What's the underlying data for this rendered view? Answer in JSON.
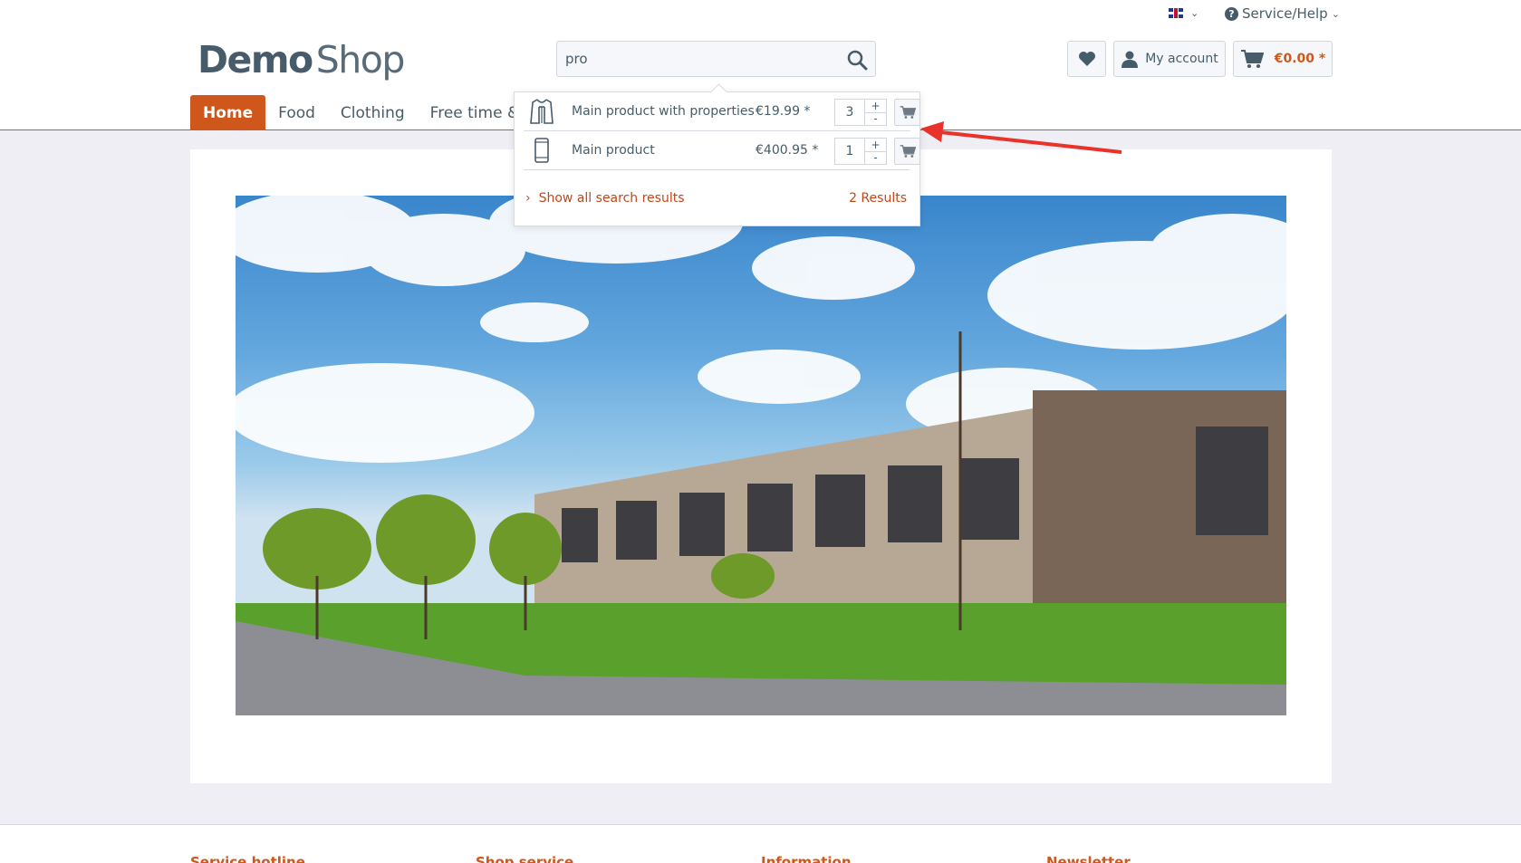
{
  "header": {
    "language_icon": "flag-gb",
    "service_label": "Service/Help",
    "logo_bold": "Demo",
    "logo_light": "Shop",
    "search": {
      "value": "pro"
    },
    "account_label": "My account",
    "cart_total": "€0.00 *"
  },
  "nav": {
    "items": [
      {
        "label": "Home",
        "active": true
      },
      {
        "label": "Food"
      },
      {
        "label": "Clothing"
      },
      {
        "label": "Free time & Ele"
      }
    ]
  },
  "search_results": {
    "items": [
      {
        "name": "Main product with properties",
        "price": "€19.99 *",
        "quantity": "3",
        "icon": "jacket-icon"
      },
      {
        "name": "Main product",
        "price": "€400.95 *",
        "quantity": "1",
        "icon": "smartphone-icon"
      }
    ],
    "show_all_label": "Show all search results",
    "result_count": "2 Results"
  },
  "footer": {
    "columns": [
      "Service hotline",
      "Shop service",
      "Information",
      "Newsletter"
    ]
  },
  "colors": {
    "accent": "#d0571c",
    "text": "#475c6a",
    "background": "#eeeef4",
    "annotation_arrow": "#e8322a"
  }
}
